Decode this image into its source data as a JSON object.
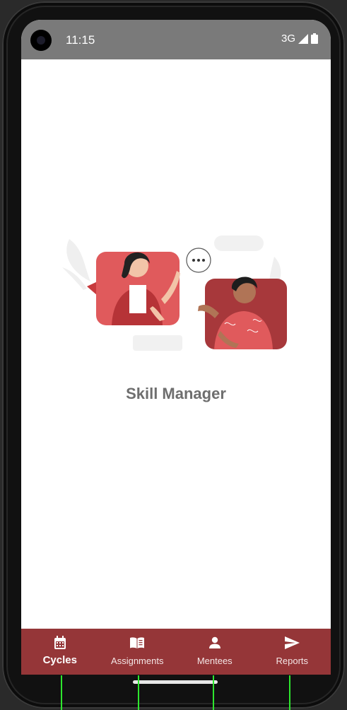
{
  "status_bar": {
    "time": "11:15",
    "network": "3G",
    "icons": [
      "signal-icon",
      "battery-icon"
    ]
  },
  "main": {
    "app_title": "Skill Manager",
    "illustration": "two-people-video-chat-illustration"
  },
  "bottom_nav": {
    "items": [
      {
        "label": "Cycles",
        "icon": "calendar-icon",
        "active": true
      },
      {
        "label": "Assignments",
        "icon": "book-icon",
        "active": false
      },
      {
        "label": "Mentees",
        "icon": "person-icon",
        "active": false
      },
      {
        "label": "Reports",
        "icon": "send-icon",
        "active": false
      }
    ]
  },
  "colors": {
    "accent": "#953638",
    "status_bar": "#7a7a7a",
    "title_text": "#6e6e6e",
    "illustration_red": "#e05a5c"
  }
}
